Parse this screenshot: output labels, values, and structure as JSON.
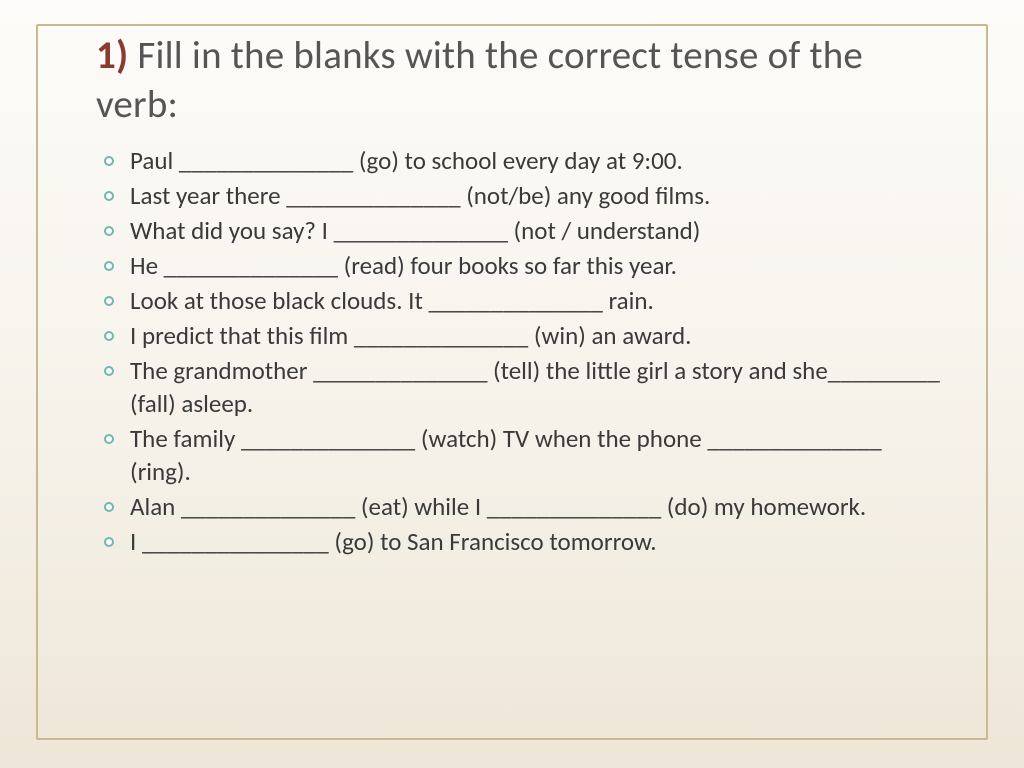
{
  "title_lead": "1)",
  "title_rest": " Fill in the blanks with the correct tense of the verb:",
  "items": [
    "Paul ______________ (go) to school every day at 9:00.",
    "Last year there ______________ (not/be) any good films.",
    "What did you say? I ______________ (not / understand)",
    "He ______________ (read) four books so far this year.",
    "Look at those black clouds. It ______________ rain.",
    "I predict that this film ______________ (win) an award.",
    "The grandmother ______________ (tell) the little girl a story and she_________ (fall) asleep.",
    "The family ______________ (watch) TV when the phone ______________ (ring).",
    "Alan ______________ (eat) while I ______________ (do) my homework.",
    " I _______________ (go) to San Francisco tomorrow."
  ]
}
